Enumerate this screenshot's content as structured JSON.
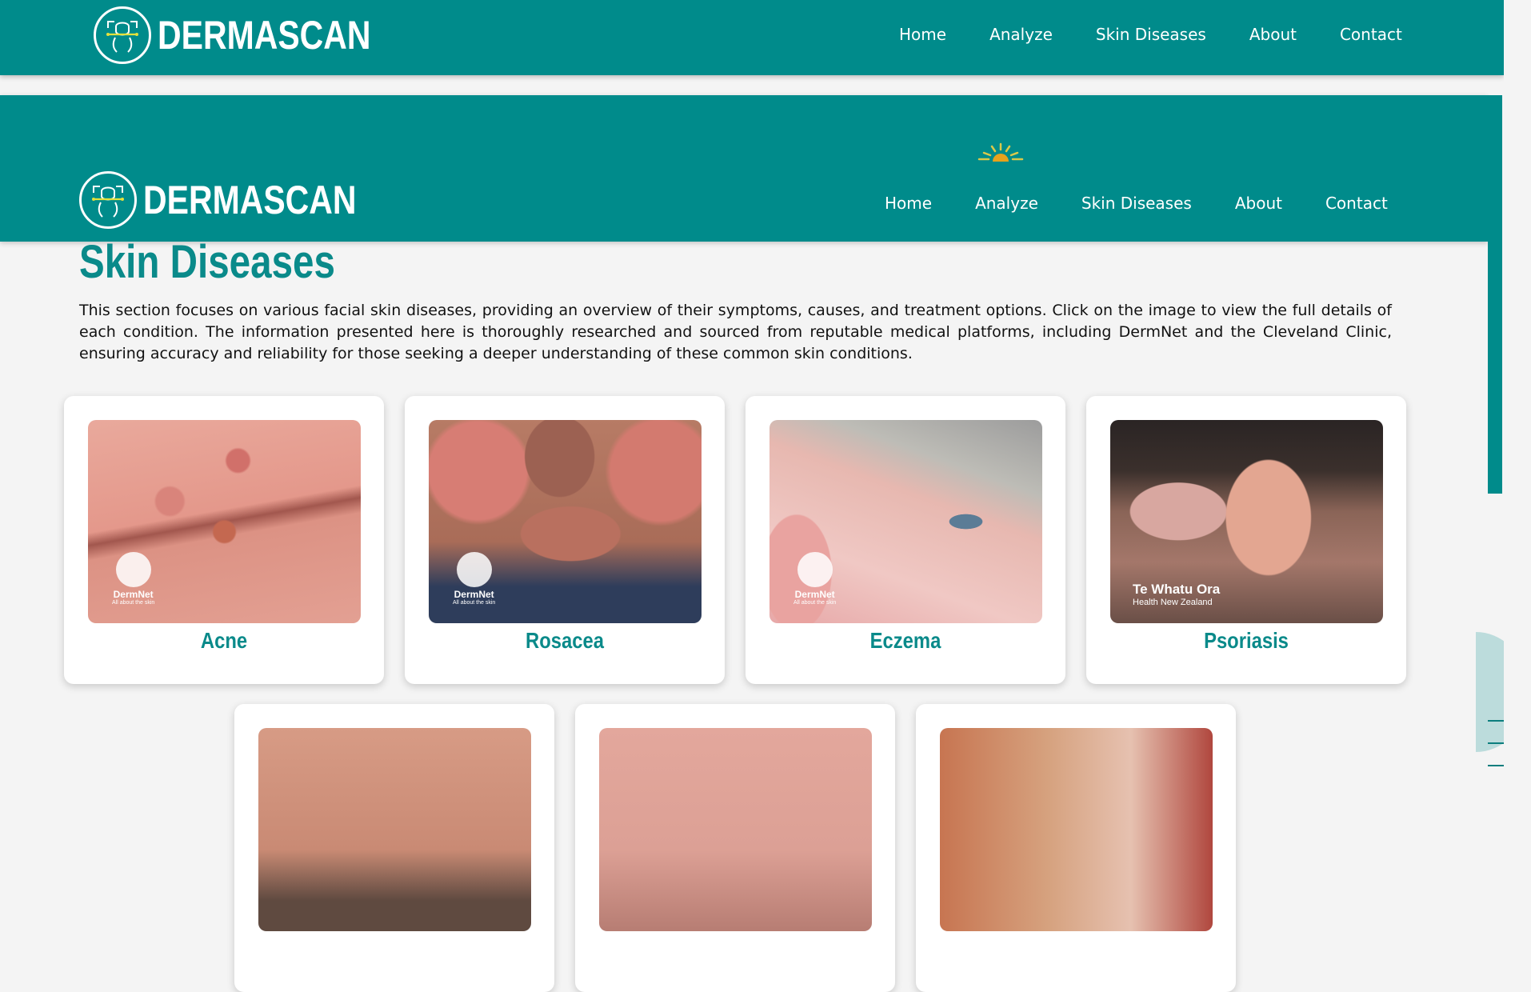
{
  "brand": {
    "name": "DERMASCAN",
    "logo_icon": "face-scan-icon"
  },
  "nav": {
    "items": [
      {
        "label": "Home"
      },
      {
        "label": "Analyze"
      },
      {
        "label": "Skin Diseases"
      },
      {
        "label": "About"
      },
      {
        "label": "Contact"
      }
    ]
  },
  "page": {
    "title": "Skin Diseases",
    "intro": "This section focuses on various facial skin diseases, providing an overview of their symptoms, causes, and treatment options. Click on the image to view the full details of each condition. The information presented here is thoroughly researched and sourced from reputable medical platforms, including DermNet and the Cleveland Clinic, ensuring accuracy and reliability for those seeking a deeper understanding of these common skin conditions."
  },
  "cards": [
    {
      "title": "Acne",
      "watermark": "DermNet",
      "watermark_sub": "All about the skin"
    },
    {
      "title": "Rosacea",
      "watermark": "DermNet",
      "watermark_sub": "All about the skin"
    },
    {
      "title": "Eczema",
      "watermark": "DermNet",
      "watermark_sub": "All about the skin"
    },
    {
      "title": "Psoriasis",
      "watermark": "Te Whatu Ora",
      "watermark_sub": "Health New Zealand"
    }
  ],
  "colors": {
    "brand": "#008b8b",
    "accent_text": "#0a8a8a",
    "background": "#f4f4f4"
  }
}
